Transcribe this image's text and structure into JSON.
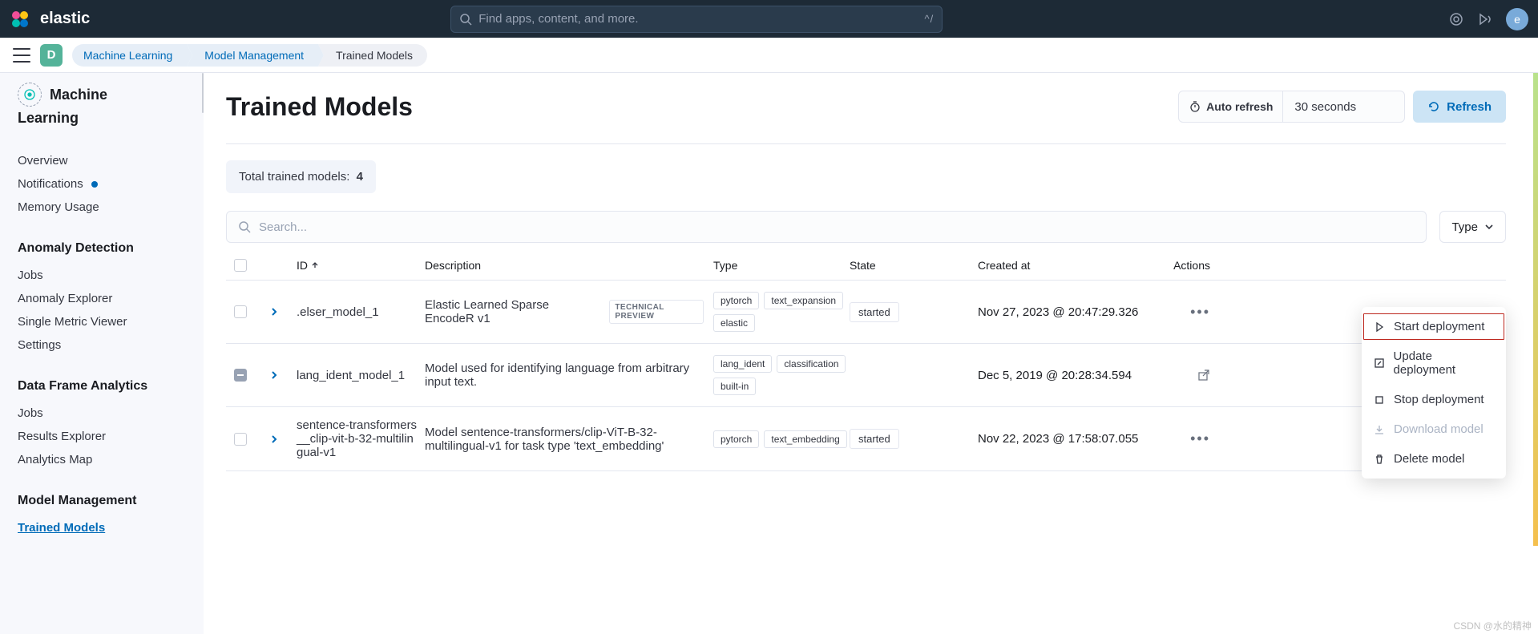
{
  "brand": "elastic",
  "search_placeholder": "Find apps, content, and more.",
  "search_shortcut": "^/",
  "avatar_letter": "e",
  "space_letter": "D",
  "breadcrumbs": [
    "Machine Learning",
    "Model Management",
    "Trained Models"
  ],
  "sidebar": {
    "app": "Machine",
    "app_sub": "Learning",
    "groups": [
      {
        "title": "",
        "items": [
          "Overview",
          "Notifications",
          "Memory Usage"
        ],
        "dot_index": 1
      },
      {
        "title": "Anomaly Detection",
        "items": [
          "Jobs",
          "Anomaly Explorer",
          "Single Metric Viewer",
          "Settings"
        ]
      },
      {
        "title": "Data Frame Analytics",
        "items": [
          "Jobs",
          "Results Explorer",
          "Analytics Map"
        ]
      },
      {
        "title": "Model Management",
        "items": [
          "Trained Models"
        ],
        "active_index": 0
      }
    ]
  },
  "page": {
    "title": "Trained Models",
    "auto_refresh_label": "Auto refresh",
    "auto_refresh_value": "30 seconds",
    "refresh_label": "Refresh",
    "total_label": "Total trained models:",
    "total_count": "4",
    "search_placeholder": "Search...",
    "type_filter_label": "Type"
  },
  "table": {
    "columns": [
      "ID",
      "Description",
      "Type",
      "State",
      "Created at",
      "Actions"
    ],
    "rows": [
      {
        "id": ".elser_model_1",
        "description": "Elastic Learned Sparse EncodeR v1",
        "tech_preview": "TECHNICAL PREVIEW",
        "types": [
          "pytorch",
          "text_expansion",
          "elastic"
        ],
        "state": "started",
        "created": "Nov 27, 2023 @ 20:47:29.326",
        "checked": false
      },
      {
        "id": "lang_ident_model_1",
        "description": "Model used for identifying language from arbitrary input text.",
        "types": [
          "lang_ident",
          "classification",
          "built-in"
        ],
        "state": "",
        "created": "Dec 5, 2019 @ 20:28:34.594",
        "checked": "indeterminate"
      },
      {
        "id": "sentence-transformers__clip-vit-b-32-multilingual-v1",
        "description": "Model sentence-transformers/clip-ViT-B-32-multilingual-v1 for task type 'text_embedding'",
        "types": [
          "pytorch",
          "text_embedding"
        ],
        "state": "started",
        "created": "Nov 22, 2023 @ 17:58:07.055",
        "checked": false
      }
    ]
  },
  "context_menu": [
    {
      "label": "Start deployment",
      "icon": "play",
      "highlight": true
    },
    {
      "label": "Update deployment",
      "icon": "edit"
    },
    {
      "label": "Stop deployment",
      "icon": "stop"
    },
    {
      "label": "Download model",
      "icon": "download",
      "disabled": true
    },
    {
      "label": "Delete model",
      "icon": "trash"
    }
  ],
  "watermark": "CSDN @水的精神"
}
